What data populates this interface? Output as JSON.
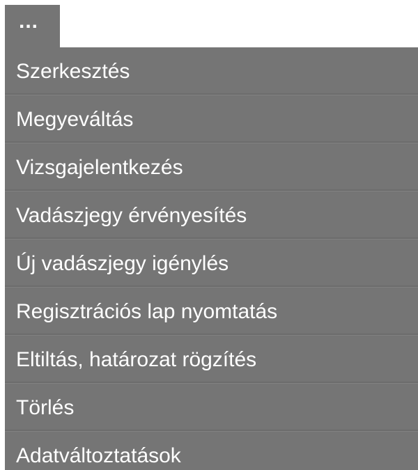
{
  "trigger": {
    "label": "..."
  },
  "menu": {
    "items": [
      {
        "label": "Szerkesztés"
      },
      {
        "label": "Megyeváltás"
      },
      {
        "label": "Vizsgajelentkezés"
      },
      {
        "label": "Vadászjegy érvényesítés"
      },
      {
        "label": "Új vadászjegy igénylés"
      },
      {
        "label": "Regisztrációs lap nyomtatás"
      },
      {
        "label": "Eltiltás, határozat rögzítés"
      },
      {
        "label": "Törlés"
      },
      {
        "label": "Adatváltoztatások"
      }
    ]
  },
  "colors": {
    "menu_background": "#757575",
    "text": "#ffffff",
    "page_background": "#ffffff"
  }
}
